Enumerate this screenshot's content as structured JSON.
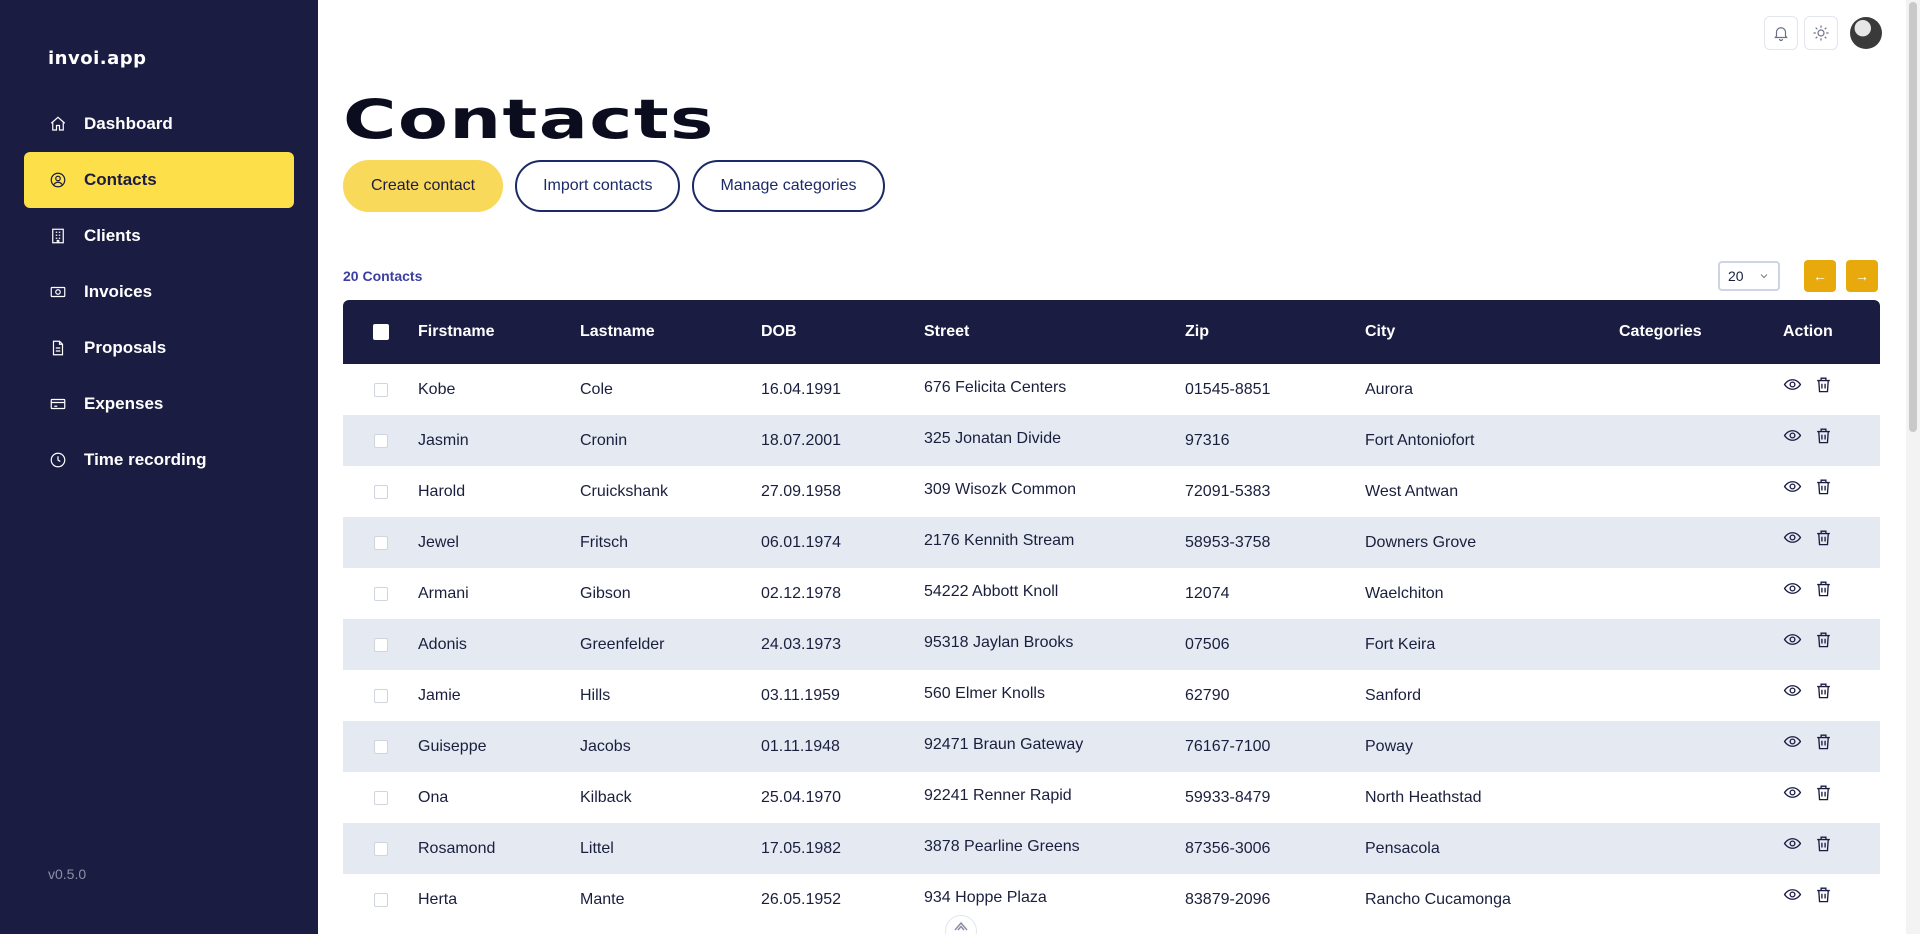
{
  "app": {
    "logo": "invoi.app",
    "version": "v0.5.0"
  },
  "sidebar": {
    "items": [
      {
        "label": "Dashboard",
        "icon": "home-icon",
        "active": false
      },
      {
        "label": "Contacts",
        "icon": "user-circle-icon",
        "active": true
      },
      {
        "label": "Clients",
        "icon": "building-icon",
        "active": false
      },
      {
        "label": "Invoices",
        "icon": "money-icon",
        "active": false
      },
      {
        "label": "Proposals",
        "icon": "document-icon",
        "active": false
      },
      {
        "label": "Expenses",
        "icon": "credit-card-icon",
        "active": false
      },
      {
        "label": "Time recording",
        "icon": "clock-icon",
        "active": false
      }
    ]
  },
  "topbar": {
    "icons": [
      "bell-icon",
      "sun-icon",
      "avatar"
    ]
  },
  "page": {
    "title": "Contacts",
    "actions": {
      "create": "Create contact",
      "import": "Import contacts",
      "manage": "Manage categories"
    },
    "count": "20 Contacts",
    "per_page": "20",
    "prev": "←",
    "next": "→"
  },
  "colors": {
    "sidebar_bg": "#1b1c42",
    "accent_yellow": "#fddf4a",
    "pager_orange": "#e7a90b",
    "row_alt": "#e4e9f2"
  },
  "table": {
    "columns": [
      "Firstname",
      "Lastname",
      "DOB",
      "Street",
      "Zip",
      "City",
      "Categories",
      "Action"
    ],
    "rows": [
      {
        "first": "Kobe",
        "last": "Cole",
        "dob": "16.04.1991",
        "street": "676 Felicita Centers",
        "zip": "01545-8851",
        "city": "Aurora",
        "cat": ""
      },
      {
        "first": "Jasmin",
        "last": "Cronin",
        "dob": "18.07.2001",
        "street": "325 Jonatan Divide",
        "zip": "97316",
        "city": "Fort Antoniofort",
        "cat": ""
      },
      {
        "first": "Harold",
        "last": "Cruickshank",
        "dob": "27.09.1958",
        "street": "309 Wisozk Common",
        "zip": "72091-5383",
        "city": "West Antwan",
        "cat": ""
      },
      {
        "first": "Jewel",
        "last": "Fritsch",
        "dob": "06.01.1974",
        "street": "2176 Kennith Stream",
        "zip": "58953-3758",
        "city": "Downers Grove",
        "cat": ""
      },
      {
        "first": "Armani",
        "last": "Gibson",
        "dob": "02.12.1978",
        "street": "54222 Abbott Knoll",
        "zip": "12074",
        "city": "Waelchiton",
        "cat": ""
      },
      {
        "first": "Adonis",
        "last": "Greenfelder",
        "dob": "24.03.1973",
        "street": "95318 Jaylan Brooks",
        "zip": "07506",
        "city": "Fort Keira",
        "cat": ""
      },
      {
        "first": "Jamie",
        "last": "Hills",
        "dob": "03.11.1959",
        "street": "560 Elmer Knolls",
        "zip": "62790",
        "city": "Sanford",
        "cat": ""
      },
      {
        "first": "Guiseppe",
        "last": "Jacobs",
        "dob": "01.11.1948",
        "street": "92471 Braun Gateway",
        "zip": "76167-7100",
        "city": "Poway",
        "cat": ""
      },
      {
        "first": "Ona",
        "last": "Kilback",
        "dob": "25.04.1970",
        "street": "92241 Renner Rapid",
        "zip": "59933-8479",
        "city": "North Heathstad",
        "cat": ""
      },
      {
        "first": "Rosamond",
        "last": "Littel",
        "dob": "17.05.1982",
        "street": "3878 Pearline Greens",
        "zip": "87356-3006",
        "city": "Pensacola",
        "cat": ""
      },
      {
        "first": "Herta",
        "last": "Mante",
        "dob": "26.05.1952",
        "street": "934 Hoppe Plaza",
        "zip": "83879-2096",
        "city": "Rancho Cucamonga",
        "cat": ""
      }
    ]
  }
}
